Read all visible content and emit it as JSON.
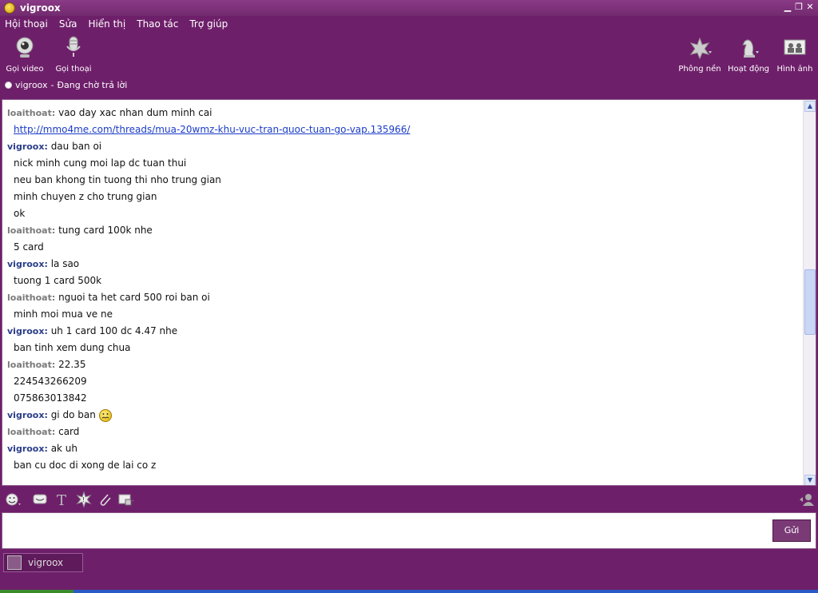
{
  "window": {
    "title": "vigroox"
  },
  "menu": [
    "Hội thoại",
    "Sửa",
    "Hiển thị",
    "Thao tác",
    "Trợ giúp"
  ],
  "toolbar": {
    "video_call": "Gọi video",
    "voice_call": "Gọi thoại",
    "background": "Phông nền",
    "activities": "Hoạt động",
    "photos": "Hình ảnh"
  },
  "status": {
    "contact": "vigroox",
    "separator": "-",
    "text": "Đang chờ trả lời"
  },
  "messages": [
    {
      "sender": "loaithoat",
      "side": "lo",
      "lines": [
        "vao day xac nhan dum minh cai"
      ],
      "link": "http://mmo4me.com/threads/mua-20wmz-khu-vuc-tran-quoc-tuan-go-vap.135966/"
    },
    {
      "sender": "vigroox",
      "side": "vi",
      "lines": [
        "dau ban oi",
        "nick minh cung moi lap dc tuan thui",
        "neu ban khong tin tuong thi nho trung gian",
        "minh chuyen z cho trung gian",
        "ok"
      ]
    },
    {
      "sender": "loaithoat",
      "side": "lo",
      "lines": [
        "tung card 100k nhe",
        "5 card"
      ]
    },
    {
      "sender": "vigroox",
      "side": "vi",
      "lines": [
        "la sao",
        "tuong 1 card 500k"
      ]
    },
    {
      "sender": "loaithoat",
      "side": "lo",
      "lines": [
        "nguoi ta het card 500 roi ban oi",
        "minh moi mua ve ne"
      ]
    },
    {
      "sender": "vigroox",
      "side": "vi",
      "lines": [
        "uh 1 card 100 dc 4.47 nhe",
        "ban tinh xem dung chua"
      ]
    },
    {
      "sender": "loaithoat",
      "side": "lo",
      "lines": [
        "22.35",
        "224543266209",
        "075863013842"
      ]
    },
    {
      "sender": "vigroox",
      "side": "vi",
      "lines": [
        "gi do ban"
      ],
      "emoji": "confused-smiley"
    },
    {
      "sender": "loaithoat",
      "side": "lo",
      "lines": [
        "card"
      ]
    },
    {
      "sender": "vigroox",
      "side": "vi",
      "lines": [
        "ak uh",
        "ban cu doc di xong de lai co z"
      ]
    }
  ],
  "input": {
    "send_label": "Gửi",
    "value": ""
  },
  "tabs": [
    {
      "label": "vigroox"
    }
  ],
  "colors": {
    "frame": "#6e1f6a",
    "sender_lo": "#7a7a7a",
    "sender_vi": "#2a3d8a",
    "link": "#1a3cc8"
  }
}
